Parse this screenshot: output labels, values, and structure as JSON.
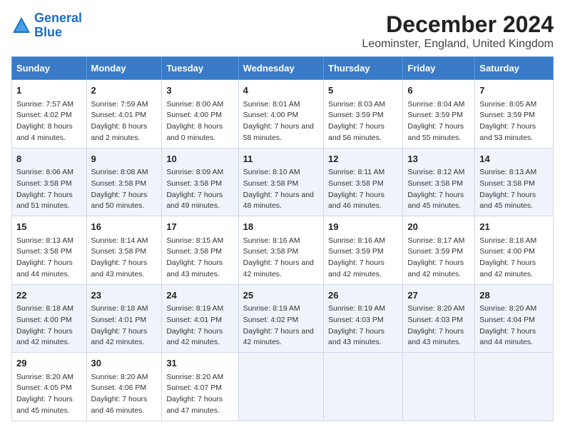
{
  "logo": {
    "line1": "General",
    "line2": "Blue"
  },
  "title": "December 2024",
  "subtitle": "Leominster, England, United Kingdom",
  "days_header": [
    "Sunday",
    "Monday",
    "Tuesday",
    "Wednesday",
    "Thursday",
    "Friday",
    "Saturday"
  ],
  "weeks": [
    [
      {
        "day": "1",
        "sunrise": "Sunrise: 7:57 AM",
        "sunset": "Sunset: 4:02 PM",
        "daylight": "Daylight: 8 hours and 4 minutes."
      },
      {
        "day": "2",
        "sunrise": "Sunrise: 7:59 AM",
        "sunset": "Sunset: 4:01 PM",
        "daylight": "Daylight: 8 hours and 2 minutes."
      },
      {
        "day": "3",
        "sunrise": "Sunrise: 8:00 AM",
        "sunset": "Sunset: 4:00 PM",
        "daylight": "Daylight: 8 hours and 0 minutes."
      },
      {
        "day": "4",
        "sunrise": "Sunrise: 8:01 AM",
        "sunset": "Sunset: 4:00 PM",
        "daylight": "Daylight: 7 hours and 58 minutes."
      },
      {
        "day": "5",
        "sunrise": "Sunrise: 8:03 AM",
        "sunset": "Sunset: 3:59 PM",
        "daylight": "Daylight: 7 hours and 56 minutes."
      },
      {
        "day": "6",
        "sunrise": "Sunrise: 8:04 AM",
        "sunset": "Sunset: 3:59 PM",
        "daylight": "Daylight: 7 hours and 55 minutes."
      },
      {
        "day": "7",
        "sunrise": "Sunrise: 8:05 AM",
        "sunset": "Sunset: 3:59 PM",
        "daylight": "Daylight: 7 hours and 53 minutes."
      }
    ],
    [
      {
        "day": "8",
        "sunrise": "Sunrise: 8:06 AM",
        "sunset": "Sunset: 3:58 PM",
        "daylight": "Daylight: 7 hours and 51 minutes."
      },
      {
        "day": "9",
        "sunrise": "Sunrise: 8:08 AM",
        "sunset": "Sunset: 3:58 PM",
        "daylight": "Daylight: 7 hours and 50 minutes."
      },
      {
        "day": "10",
        "sunrise": "Sunrise: 8:09 AM",
        "sunset": "Sunset: 3:58 PM",
        "daylight": "Daylight: 7 hours and 49 minutes."
      },
      {
        "day": "11",
        "sunrise": "Sunrise: 8:10 AM",
        "sunset": "Sunset: 3:58 PM",
        "daylight": "Daylight: 7 hours and 48 minutes."
      },
      {
        "day": "12",
        "sunrise": "Sunrise: 8:11 AM",
        "sunset": "Sunset: 3:58 PM",
        "daylight": "Daylight: 7 hours and 46 minutes."
      },
      {
        "day": "13",
        "sunrise": "Sunrise: 8:12 AM",
        "sunset": "Sunset: 3:58 PM",
        "daylight": "Daylight: 7 hours and 45 minutes."
      },
      {
        "day": "14",
        "sunrise": "Sunrise: 8:13 AM",
        "sunset": "Sunset: 3:58 PM",
        "daylight": "Daylight: 7 hours and 45 minutes."
      }
    ],
    [
      {
        "day": "15",
        "sunrise": "Sunrise: 8:13 AM",
        "sunset": "Sunset: 3:58 PM",
        "daylight": "Daylight: 7 hours and 44 minutes."
      },
      {
        "day": "16",
        "sunrise": "Sunrise: 8:14 AM",
        "sunset": "Sunset: 3:58 PM",
        "daylight": "Daylight: 7 hours and 43 minutes."
      },
      {
        "day": "17",
        "sunrise": "Sunrise: 8:15 AM",
        "sunset": "Sunset: 3:58 PM",
        "daylight": "Daylight: 7 hours and 43 minutes."
      },
      {
        "day": "18",
        "sunrise": "Sunrise: 8:16 AM",
        "sunset": "Sunset: 3:58 PM",
        "daylight": "Daylight: 7 hours and 42 minutes."
      },
      {
        "day": "19",
        "sunrise": "Sunrise: 8:16 AM",
        "sunset": "Sunset: 3:59 PM",
        "daylight": "Daylight: 7 hours and 42 minutes."
      },
      {
        "day": "20",
        "sunrise": "Sunrise: 8:17 AM",
        "sunset": "Sunset: 3:59 PM",
        "daylight": "Daylight: 7 hours and 42 minutes."
      },
      {
        "day": "21",
        "sunrise": "Sunrise: 8:18 AM",
        "sunset": "Sunset: 4:00 PM",
        "daylight": "Daylight: 7 hours and 42 minutes."
      }
    ],
    [
      {
        "day": "22",
        "sunrise": "Sunrise: 8:18 AM",
        "sunset": "Sunset: 4:00 PM",
        "daylight": "Daylight: 7 hours and 42 minutes."
      },
      {
        "day": "23",
        "sunrise": "Sunrise: 8:18 AM",
        "sunset": "Sunset: 4:01 PM",
        "daylight": "Daylight: 7 hours and 42 minutes."
      },
      {
        "day": "24",
        "sunrise": "Sunrise: 8:19 AM",
        "sunset": "Sunset: 4:01 PM",
        "daylight": "Daylight: 7 hours and 42 minutes."
      },
      {
        "day": "25",
        "sunrise": "Sunrise: 8:19 AM",
        "sunset": "Sunset: 4:02 PM",
        "daylight": "Daylight: 7 hours and 42 minutes."
      },
      {
        "day": "26",
        "sunrise": "Sunrise: 8:19 AM",
        "sunset": "Sunset: 4:03 PM",
        "daylight": "Daylight: 7 hours and 43 minutes."
      },
      {
        "day": "27",
        "sunrise": "Sunrise: 8:20 AM",
        "sunset": "Sunset: 4:03 PM",
        "daylight": "Daylight: 7 hours and 43 minutes."
      },
      {
        "day": "28",
        "sunrise": "Sunrise: 8:20 AM",
        "sunset": "Sunset: 4:04 PM",
        "daylight": "Daylight: 7 hours and 44 minutes."
      }
    ],
    [
      {
        "day": "29",
        "sunrise": "Sunrise: 8:20 AM",
        "sunset": "Sunset: 4:05 PM",
        "daylight": "Daylight: 7 hours and 45 minutes."
      },
      {
        "day": "30",
        "sunrise": "Sunrise: 8:20 AM",
        "sunset": "Sunset: 4:06 PM",
        "daylight": "Daylight: 7 hours and 46 minutes."
      },
      {
        "day": "31",
        "sunrise": "Sunrise: 8:20 AM",
        "sunset": "Sunset: 4:07 PM",
        "daylight": "Daylight: 7 hours and 47 minutes."
      },
      null,
      null,
      null,
      null
    ]
  ]
}
